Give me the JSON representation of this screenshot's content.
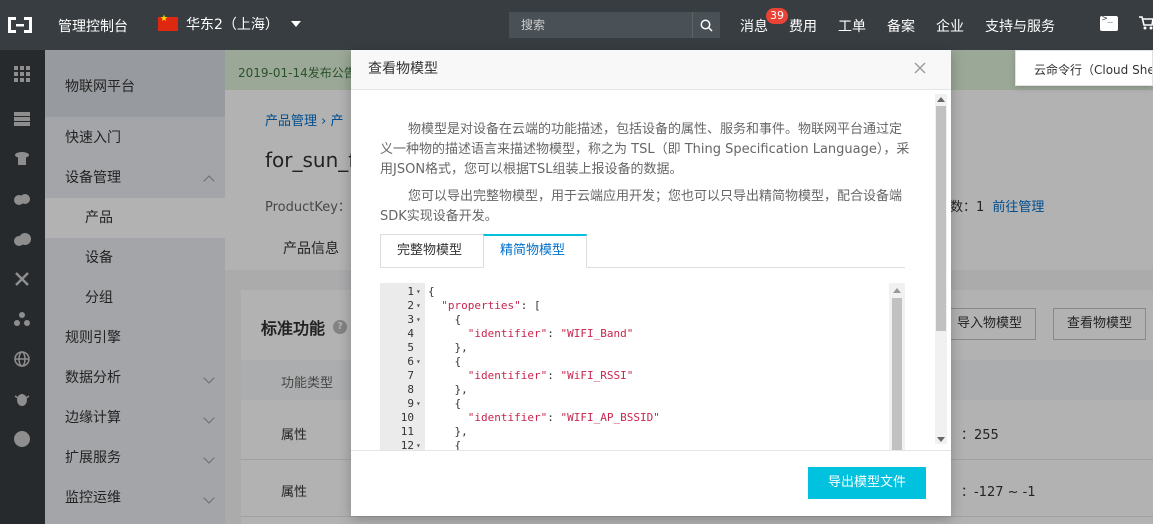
{
  "topbar": {
    "console_label": "管理控制台",
    "region": "华东2（上海）",
    "search_placeholder": "搜索",
    "links": [
      "消息",
      "费用",
      "工单",
      "备案",
      "企业",
      "支持与服务"
    ],
    "message_count": "39",
    "cloud_shell_tooltip": "云命令行（Cloud Shell）"
  },
  "sidebar": {
    "title": "物联网平台",
    "items": [
      {
        "label": "快速入门"
      },
      {
        "label": "设备管理"
      },
      {
        "label": "产品"
      },
      {
        "label": "设备"
      },
      {
        "label": "分组"
      },
      {
        "label": "规则引擎"
      },
      {
        "label": "数据分析"
      },
      {
        "label": "边缘计算"
      },
      {
        "label": "扩展服务"
      },
      {
        "label": "监控运维"
      }
    ]
  },
  "main": {
    "notice": "2019-01-14发布公告",
    "breadcrumb": "产品管理  ›  产",
    "product_name": "for_sun_fa",
    "product_key_label": "ProductKey：",
    "device_count_label": "数：1",
    "manage_link": "前往管理",
    "tab_info": "产品信息",
    "section_title": "标准功能",
    "import_button": "导入物模型",
    "view_button": "查看物模型",
    "col_type": "功能类型",
    "rows": [
      {
        "type": "属性",
        "range": "：255"
      },
      {
        "type": "属性",
        "range": "：-127 ~ -1"
      }
    ]
  },
  "modal": {
    "title": "查看物模型",
    "desc1": "物模型是对设备在云端的功能描述，包括设备的属性、服务和事件。物联网平台通过定义一种物的描述语言来描述物模型，称之为 TSL（即 Thing Specification Language），采用JSON格式，您可以根据TSL组装上报设备的数据。",
    "desc2": "您可以导出完整物模型，用于云端应用开发；您也可以只导出精简物模型，配合设备端SDK实现设备开发。",
    "tab_full": "完整物模型",
    "tab_simple": "精简物模型",
    "code_lines": [
      {
        "n": "1",
        "fold": true,
        "text": "{"
      },
      {
        "n": "2",
        "fold": true,
        "text": "  \"properties\": ["
      },
      {
        "n": "3",
        "fold": true,
        "text": "    {"
      },
      {
        "n": "4",
        "fold": false,
        "text": "      \"identifier\": \"WIFI_Band\""
      },
      {
        "n": "5",
        "fold": false,
        "text": "    },"
      },
      {
        "n": "6",
        "fold": true,
        "text": "    {"
      },
      {
        "n": "7",
        "fold": false,
        "text": "      \"identifier\": \"WiFI_RSSI\""
      },
      {
        "n": "8",
        "fold": false,
        "text": "    },"
      },
      {
        "n": "9",
        "fold": true,
        "text": "    {"
      },
      {
        "n": "10",
        "fold": false,
        "text": "      \"identifier\": \"WIFI_AP_BSSID\""
      },
      {
        "n": "11",
        "fold": false,
        "text": "    },"
      },
      {
        "n": "12",
        "fold": true,
        "text": "    {"
      }
    ],
    "export_button": "导出模型文件"
  },
  "colors": {
    "topbar_bg": "#373d41",
    "accent": "#00c1de",
    "link": "#0070cc",
    "badge": "#e84335"
  }
}
